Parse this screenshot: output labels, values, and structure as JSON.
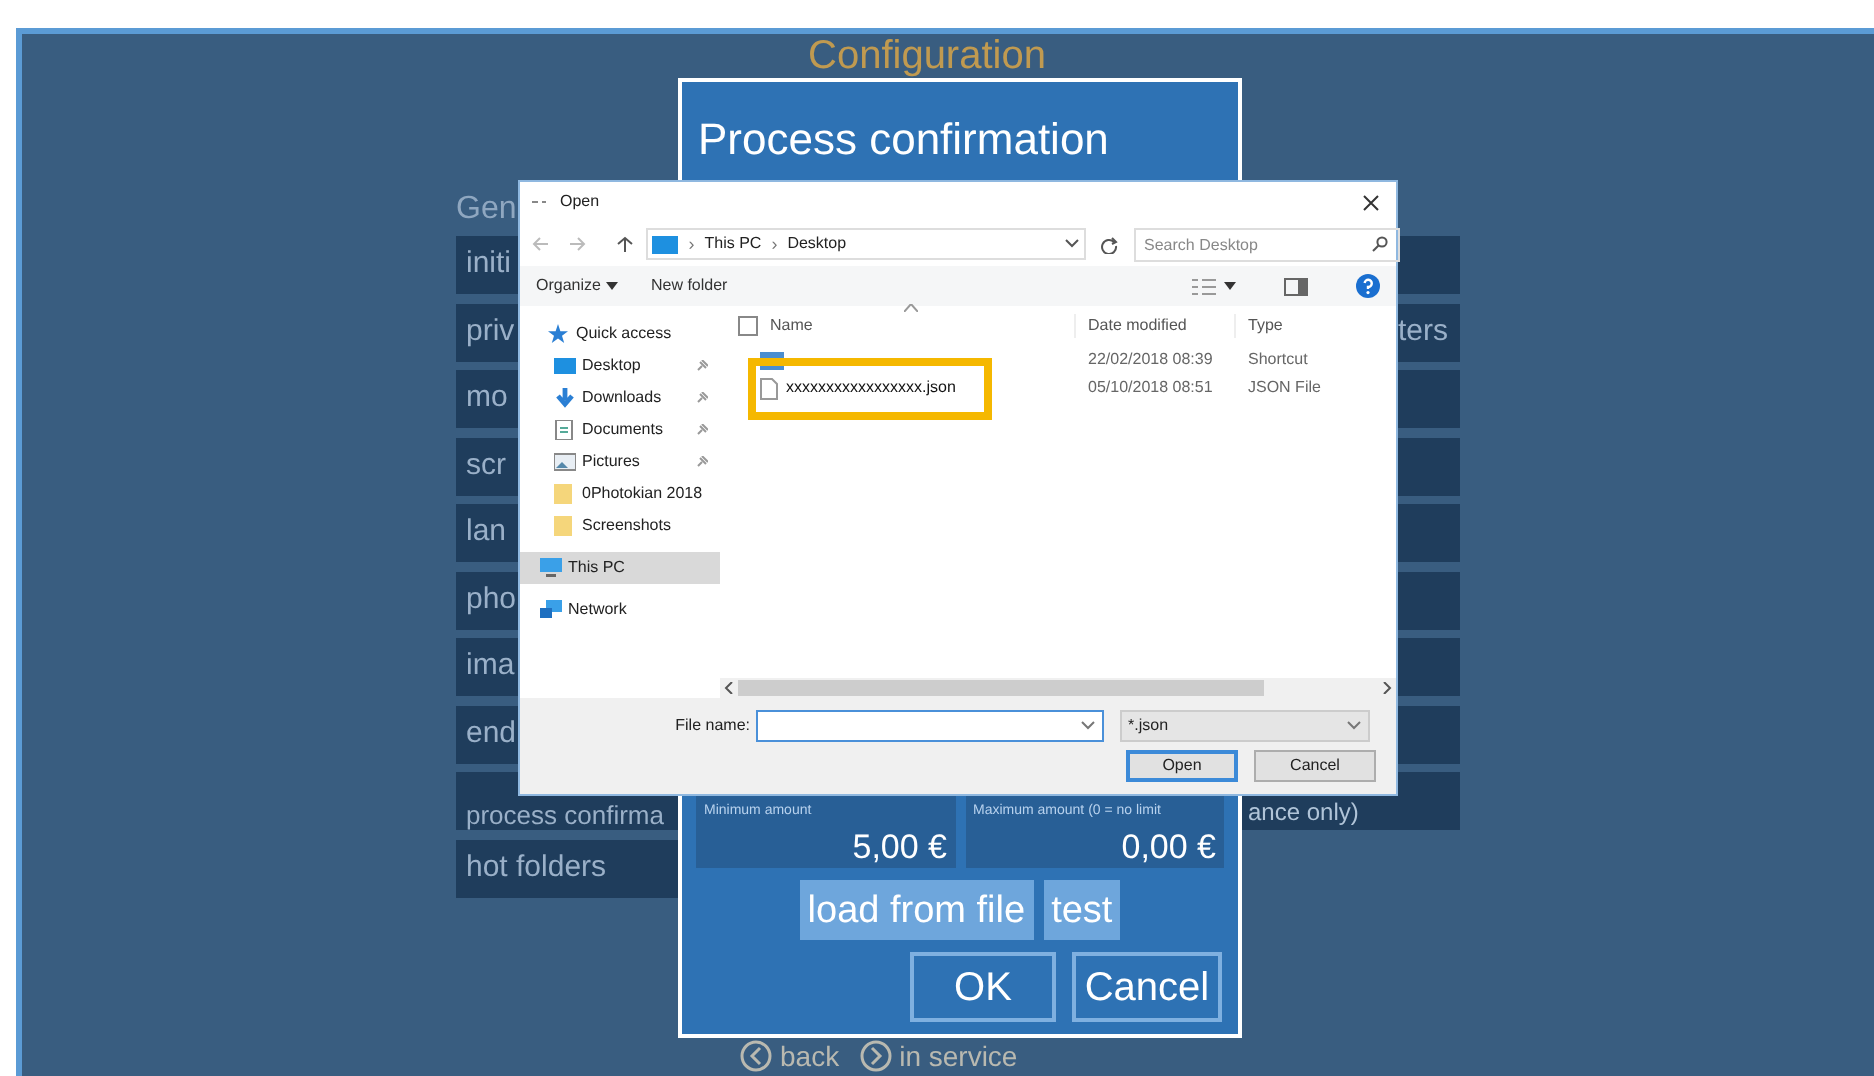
{
  "app": {
    "title": "Configuration",
    "section": "Gen",
    "menu": [
      {
        "label": "initi"
      },
      {
        "label": "priv"
      },
      {
        "label": "mo"
      },
      {
        "label": "scr"
      },
      {
        "label": "lan"
      },
      {
        "label": "pho"
      },
      {
        "label": "ima"
      },
      {
        "label": "end"
      },
      {
        "label": "process confirma"
      },
      {
        "label": "hot folders"
      }
    ],
    "right_column": [
      {
        "kind": "blank"
      },
      {
        "kind": "text",
        "label": "ters"
      },
      {
        "kind": "blank"
      },
      {
        "kind": "blank"
      },
      {
        "kind": "blank"
      },
      {
        "kind": "blank"
      },
      {
        "kind": "blank"
      },
      {
        "kind": "blank"
      },
      {
        "kind": "blank"
      }
    ],
    "footer": [
      {
        "kind": "back",
        "label": "back"
      },
      {
        "kind": "play",
        "label": "in service"
      }
    ]
  },
  "dialog": {
    "title": "Process confirmation",
    "fields": [
      {
        "label": "Minimum amount",
        "value": "5,00 €"
      },
      {
        "label": "Maximum amount (0 = no limit",
        "tail": "ance only)",
        "value": "0,00 €"
      }
    ],
    "actions": [
      "load from file",
      "test"
    ],
    "buttons": [
      "OK",
      "Cancel"
    ]
  },
  "file_dialog": {
    "title": "Open",
    "path": [
      {
        "separator": "›",
        "label": "This PC"
      },
      {
        "separator": "›",
        "label": "Desktop"
      }
    ],
    "search": {
      "placeholder": "Search Desktop"
    },
    "toolbar": [
      "Organize",
      "New folder"
    ],
    "nav": [
      {
        "kind": "star",
        "label": "Quick access",
        "pinned": false,
        "selected": false
      },
      {
        "kind": "desktop",
        "label": "Desktop",
        "pinned": true,
        "selected": false
      },
      {
        "kind": "download",
        "label": "Downloads",
        "pinned": true,
        "selected": false
      },
      {
        "kind": "document",
        "label": "Documents",
        "pinned": true,
        "selected": false
      },
      {
        "kind": "pictures",
        "label": "Pictures",
        "pinned": true,
        "selected": false
      },
      {
        "kind": "folder",
        "label": "0Photokian 2018",
        "pinned": false,
        "selected": false
      },
      {
        "kind": "folder",
        "label": "Screenshots",
        "pinned": false,
        "selected": false
      },
      {
        "kind": "pc",
        "label": "This PC",
        "pinned": false,
        "selected": true
      },
      {
        "kind": "network",
        "label": "Network",
        "pinned": false,
        "selected": false
      }
    ],
    "select_all": {
      "checked": false
    },
    "columns": [
      "Name",
      "Date modified",
      "Type"
    ],
    "files": [
      {
        "kind": "shortcut",
        "date": "22/02/2018 08:39",
        "type": "Shortcut",
        "highlighted": false
      },
      {
        "kind": "file",
        "name": "xxxxxxxxxxxxxxxxx.json",
        "date": "05/10/2018 08:51",
        "type": "JSON File",
        "highlighted": true
      }
    ],
    "file_name": {
      "label": "File name:"
    },
    "filter": "*.json",
    "buttons": [
      "Open",
      "Cancel"
    ]
  }
}
